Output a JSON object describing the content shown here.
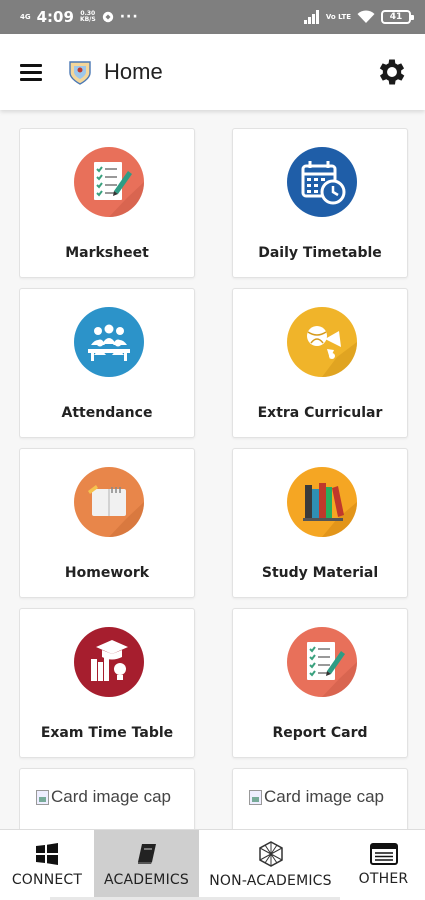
{
  "status_bar": {
    "network": "4G",
    "time": "4:09",
    "speed_value": "0.30",
    "speed_unit": "KB/S",
    "more": "···",
    "lte_label": "Vo LTE",
    "battery": "41"
  },
  "app_bar": {
    "title": "Home",
    "menu_icon": "hamburger-menu-icon",
    "settings_icon": "gear-icon"
  },
  "cards": [
    {
      "label": "Marksheet",
      "icon": "checklist-document-icon",
      "color": "#e8705a"
    },
    {
      "label": "Daily Timetable",
      "icon": "calendar-clock-icon",
      "color": "#1f5ea8"
    },
    {
      "label": "Attendance",
      "icon": "students-group-icon",
      "color": "#2c93c9"
    },
    {
      "label": "Extra Curricular",
      "icon": "sports-ball-icon",
      "color": "#f0b42a"
    },
    {
      "label": "Homework",
      "icon": "notebook-icon",
      "color": "#e8864a"
    },
    {
      "label": "Study Material",
      "icon": "books-icon",
      "color": "#f5a623"
    },
    {
      "label": "Exam Time Table",
      "icon": "graduation-cap-books-icon",
      "color": "#a61e2e"
    },
    {
      "label": "Report Card",
      "icon": "checklist-document-icon",
      "color": "#e8705a"
    }
  ],
  "image_cards": [
    {
      "alt": "Card image cap"
    },
    {
      "alt": "Card image cap"
    }
  ],
  "bottom_nav": [
    {
      "label": "CONNECT",
      "icon": "windows-grid-icon",
      "active": false
    },
    {
      "label": "ACADEMICS",
      "icon": "book-icon",
      "active": true
    },
    {
      "label": "NON-ACADEMICS",
      "icon": "hexagon-network-icon",
      "active": false
    },
    {
      "label": "OTHER",
      "icon": "keyboard-icon",
      "active": false
    }
  ],
  "colors": {
    "status_bar": "#7f7f7f",
    "active_tab": "#cfcfcf",
    "background": "#f7f7f7"
  }
}
